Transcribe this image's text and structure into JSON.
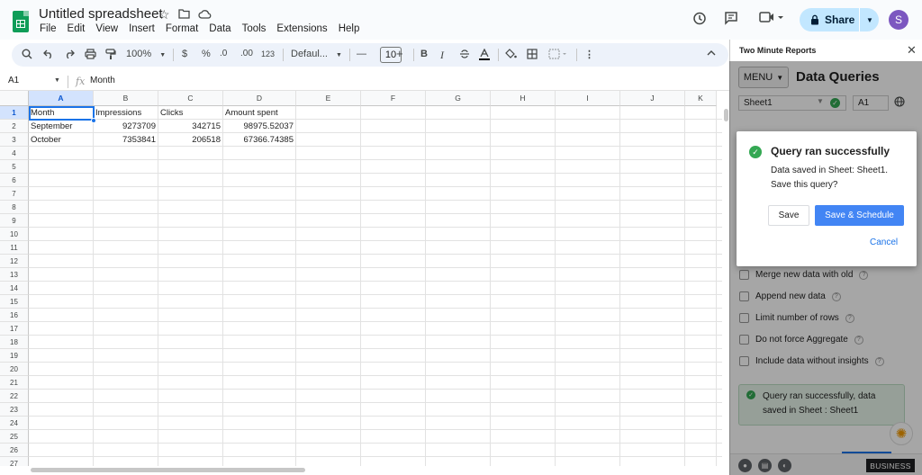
{
  "app": {
    "title": "Untitled spreadsheet",
    "menu": [
      "File",
      "Edit",
      "View",
      "Insert",
      "Format",
      "Data",
      "Tools",
      "Extensions",
      "Help"
    ],
    "share_label": "Share",
    "avatar_initial": "S"
  },
  "toolbar": {
    "zoom": "100%",
    "currency": "$",
    "percent": "%",
    "decrease_decimals": ".0",
    "increase_decimals": ".00",
    "number_format": "123",
    "font": "Defaul...",
    "font_size": "10",
    "bold": "B",
    "italic": "I"
  },
  "formula_bar": {
    "name_box": "A1",
    "fx": "fx",
    "content": "Month"
  },
  "grid": {
    "columns": [
      "A",
      "B",
      "C",
      "D",
      "E",
      "F",
      "G",
      "H",
      "I",
      "J",
      "K"
    ],
    "rows": [
      "1",
      "2",
      "3",
      "4",
      "5",
      "6",
      "7",
      "8",
      "9",
      "10",
      "11",
      "12",
      "13",
      "14",
      "15",
      "16",
      "17",
      "18",
      "19",
      "20",
      "21",
      "22",
      "23",
      "24",
      "25",
      "26",
      "27"
    ],
    "headers": [
      "Month",
      "Impressions",
      "Clicks",
      "Amount spent"
    ],
    "data": [
      [
        "September",
        "9273709",
        "342715",
        "98975.52037"
      ],
      [
        "October",
        "7353841",
        "206518",
        "67366.74385"
      ]
    ],
    "selected_cell": "A1"
  },
  "panel": {
    "title": "Two Minute Reports",
    "menu_label": "MENU",
    "heading": "Data Queries",
    "sheet": "Sheet1",
    "cell": "A1",
    "options": [
      "Merge new data with old",
      "Append new data",
      "Limit number of rows",
      "Do not force Aggregate",
      "Include data without insights"
    ],
    "status": "Query ran successfully, data saved in Sheet : Sheet1",
    "badge": "BUSINESS"
  },
  "dialog": {
    "title": "Query ran successfully",
    "message": "Data saved in Sheet: Sheet1. Save this query?",
    "save_label": "Save",
    "save_schedule_label": "Save & Schedule",
    "cancel_label": "Cancel"
  },
  "colors": {
    "accent": "#1a73e8",
    "sheets_green": "#0f9d58",
    "success_green": "#34a853",
    "primary_button": "#4285f4",
    "share_bg": "#c2e7ff"
  }
}
